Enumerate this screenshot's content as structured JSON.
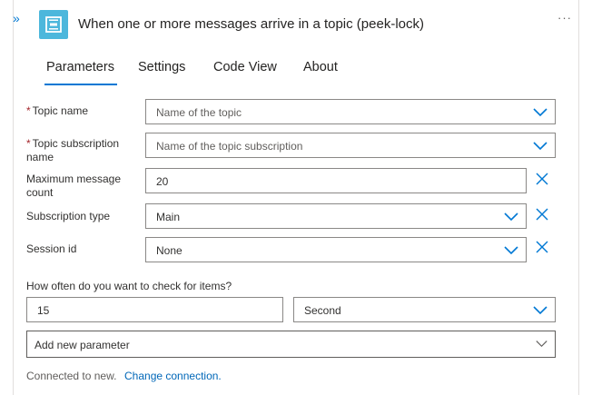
{
  "header": {
    "title": "When one or more messages arrive in a topic (peek-lock)",
    "more_label": "···",
    "collapse_label": "»"
  },
  "tabs": [
    {
      "label": "Parameters",
      "active": true
    },
    {
      "label": "Settings",
      "active": false
    },
    {
      "label": "Code View",
      "active": false
    },
    {
      "label": "About",
      "active": false
    }
  ],
  "fields": {
    "topic_name": {
      "label": "Topic name",
      "required_mark": "*",
      "placeholder": "Name of the topic"
    },
    "topic_subscription": {
      "label": "Topic subscription name",
      "required_mark": "*",
      "placeholder": "Name of the topic subscription"
    },
    "max_count": {
      "label": "Maximum message count",
      "value": "20"
    },
    "subscription_type": {
      "label": "Subscription type",
      "value": "Main"
    },
    "session_id": {
      "label": "Session id",
      "value": "None"
    }
  },
  "recurrence": {
    "label": "How often do you want to check for items?",
    "interval": "15",
    "frequency": "Second"
  },
  "add_parameter": {
    "label": "Add new parameter"
  },
  "footer": {
    "connected_text": "Connected to new.",
    "change_link": "Change connection."
  },
  "colors": {
    "accent": "#0078d4",
    "app_icon_bg": "#4cb7dc",
    "required": "#a4262c",
    "border": "#8a8886"
  },
  "icons": {
    "app": "service-bus-icon",
    "dropdown": "chevron-down-icon",
    "clear": "close-icon",
    "collapse": "double-chevron-right-icon"
  }
}
